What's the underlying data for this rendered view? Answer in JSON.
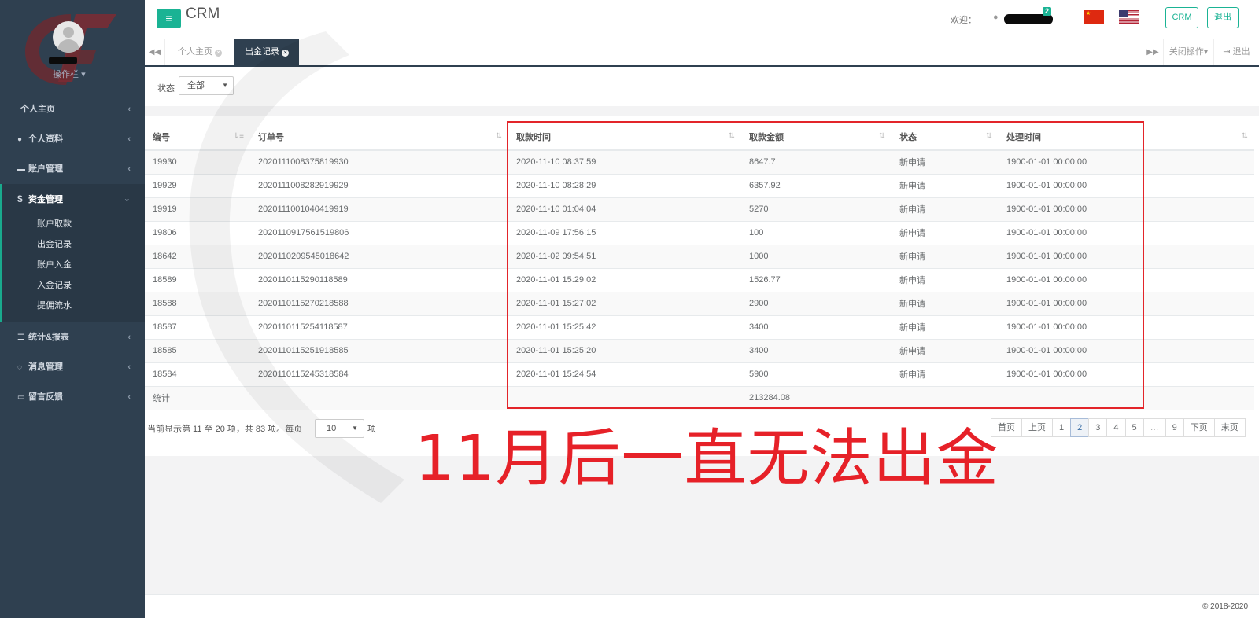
{
  "sidebar": {
    "profile_menu": "操作栏",
    "items": [
      {
        "label": "个人主页",
        "icon": "none"
      },
      {
        "label": "个人资料",
        "icon": "user-icon"
      },
      {
        "label": "账户管理",
        "icon": "id-card-icon"
      },
      {
        "label": "资金管理",
        "icon": "dollar-icon",
        "expanded": true
      },
      {
        "label": "统计&报表",
        "icon": "list-icon"
      },
      {
        "label": "消息管理",
        "icon": "comment-icon"
      },
      {
        "label": "留言反馈",
        "icon": "keyboard-icon"
      }
    ],
    "subitems": [
      "账户取款",
      "出金记录",
      "账户入金",
      "入金记录",
      "提佣流水"
    ]
  },
  "topbar": {
    "app_title": "CRM",
    "welcome": "欢迎：",
    "badge": "2",
    "crm_button": "CRM",
    "logout_button": "退出"
  },
  "tabs": {
    "items": [
      {
        "label": "个人主页",
        "active": false
      },
      {
        "label": "出金记录",
        "active": true
      }
    ],
    "close_ops": "关闭操作",
    "exit": "退出"
  },
  "filter": {
    "label": "状态",
    "value": "全部"
  },
  "table": {
    "columns": [
      "编号",
      "订单号",
      "取款时间",
      "取款金额",
      "状态",
      "处理时间"
    ],
    "rows": [
      [
        "19930",
        "2020111008375819930",
        "2020-11-10 08:37:59",
        "8647.7",
        "新申请",
        "1900-01-01 00:00:00"
      ],
      [
        "19929",
        "2020111008282919929",
        "2020-11-10 08:28:29",
        "6357.92",
        "新申请",
        "1900-01-01 00:00:00"
      ],
      [
        "19919",
        "2020111001040419919",
        "2020-11-10 01:04:04",
        "5270",
        "新申请",
        "1900-01-01 00:00:00"
      ],
      [
        "19806",
        "2020110917561519806",
        "2020-11-09 17:56:15",
        "100",
        "新申请",
        "1900-01-01 00:00:00"
      ],
      [
        "18642",
        "2020110209545018642",
        "2020-11-02 09:54:51",
        "1000",
        "新申请",
        "1900-01-01 00:00:00"
      ],
      [
        "18589",
        "2020110115290118589",
        "2020-11-01 15:29:02",
        "1526.77",
        "新申请",
        "1900-01-01 00:00:00"
      ],
      [
        "18588",
        "2020110115270218588",
        "2020-11-01 15:27:02",
        "2900",
        "新申请",
        "1900-01-01 00:00:00"
      ],
      [
        "18587",
        "2020110115254118587",
        "2020-11-01 15:25:42",
        "3400",
        "新申请",
        "1900-01-01 00:00:00"
      ],
      [
        "18585",
        "2020110115251918585",
        "2020-11-01 15:25:20",
        "3400",
        "新申请",
        "1900-01-01 00:00:00"
      ],
      [
        "18584",
        "2020110115245318584",
        "2020-11-01 15:24:54",
        "5900",
        "新申请",
        "1900-01-01 00:00:00"
      ]
    ],
    "total_label": "统计",
    "total_value": "213284.08"
  },
  "pager": {
    "info": "当前显示第 11 至 20 项，共 83 项。每页",
    "page_size": "10",
    "suffix": "项",
    "pages": [
      "首页",
      "上页",
      "1",
      "2",
      "3",
      "4",
      "5",
      "…",
      "9",
      "下页",
      "末页"
    ],
    "current": "2"
  },
  "annotation": "11月后一直无法出金",
  "footer": "© 2018-2020",
  "colors": {
    "sidebar_bg": "#2f4050",
    "accent": "#1ab394",
    "annotation_red": "#e3252a",
    "sum_green": "#1d8a2c"
  }
}
